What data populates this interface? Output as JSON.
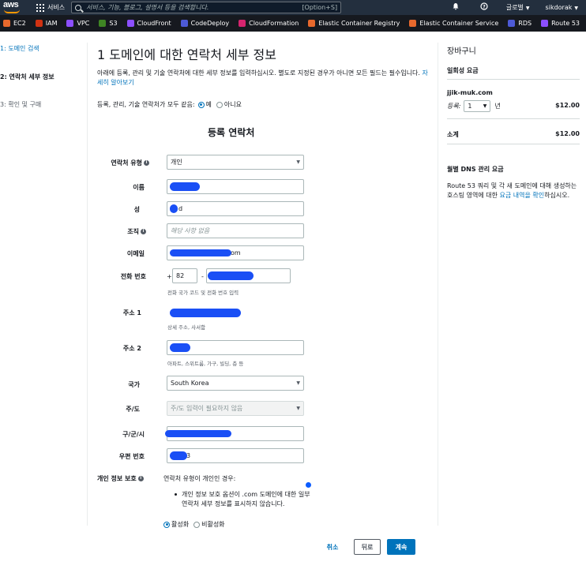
{
  "topnav": {
    "logo": "aws",
    "services_label": "서비스",
    "search_placeholder": "서비스, 기능, 블로그, 설명서 등을 검색합니다.",
    "search_shortcut": "[Option+S]",
    "bell_icon": "bell-icon",
    "help_icon": "help-icon",
    "region": "글로벌",
    "user": "sikdorak"
  },
  "favorites": [
    {
      "label": "EC2",
      "color": "#e8692d"
    },
    {
      "label": "IAM",
      "color": "#d13212"
    },
    {
      "label": "VPC",
      "color": "#8c4fff"
    },
    {
      "label": "S3",
      "color": "#3f8624"
    },
    {
      "label": "CloudFront",
      "color": "#8c4fff"
    },
    {
      "label": "CodeDeploy",
      "color": "#4d5ad6"
    },
    {
      "label": "CloudFormation",
      "color": "#d6246e"
    },
    {
      "label": "Elastic Container Registry",
      "color": "#e8692d"
    },
    {
      "label": "Elastic Container Service",
      "color": "#e8692d"
    },
    {
      "label": "RDS",
      "color": "#4d5ad6"
    },
    {
      "label": "Route 53",
      "color": "#8c4fff"
    }
  ],
  "steps": {
    "s1": "1: 도메인 검색",
    "s2": "2: 연락처 세부 정보",
    "s3": "3: 확인 및 구매"
  },
  "main": {
    "title": "1 도메인에 대한 연락처 세부 정보",
    "intro": "아래에 등록, 관리 및 기술 연락처에 대한 세부 정보를 입력하십시오. 별도로 지정된 경우가 아니면 모든 필드는 필수입니다.",
    "learn_more": "자세히 알아보기",
    "same_contacts_label": "등록, 관리, 기술 연락처가 모두 같음:",
    "yes": "예",
    "no": "아니요",
    "section_title": "등록 연락처"
  },
  "form": {
    "contact_type": {
      "label": "연락처 유형",
      "value": "개인"
    },
    "first_name": {
      "label": "이름",
      "value": ""
    },
    "last_name": {
      "label": "성",
      "value": "d"
    },
    "organization": {
      "label": "조직",
      "placeholder": "해당 사항 없음"
    },
    "email": {
      "label": "이메일",
      "value_suffix": "om"
    },
    "phone": {
      "label": "전화 번호",
      "plus": "+",
      "country_code": "82",
      "dash": "-",
      "hint": "전화 국가 코드 및 전화 번호 입력"
    },
    "address1": {
      "label": "주소 1",
      "hint": "상세 주소, 사서함"
    },
    "address2": {
      "label": "주소 2",
      "hint": "아파트, 스위트룸, 가구, 빌딩, 층 등"
    },
    "country": {
      "label": "국가",
      "value": "South Korea"
    },
    "state": {
      "label": "주/도",
      "value": "주/도 입력이 필요하지 않음"
    },
    "city": {
      "label": "구/군/시"
    },
    "postal": {
      "label": "우편 번호",
      "value_suffix": "3"
    },
    "privacy": {
      "label": "개인 정보 보호",
      "intro": "연락처 유형이 개인인 경우:",
      "bullet": "개인 정보 보호 옵션이 .com 도메인에 대한 일부 연락처 세부 정보를 표시하지 않습니다.",
      "enable": "활성화",
      "disable": "비활성화"
    }
  },
  "cart": {
    "title": "장바구니",
    "one_time_fee": "일회성 요금",
    "domain": "jjik-muk.com",
    "register_label": "등록:",
    "years_value": "1",
    "years_unit": "년",
    "price": "$12.00",
    "subtotal_label": "소계",
    "subtotal_price": "$12.00",
    "dns_title": "월별 DNS 관리 요금",
    "dns_text_pre": "Route 53 쿼리 및 각 새 도메인에 대해 생성하는 호스팅 영역에 대한",
    "dns_link": "요금 내역을 확인",
    "dns_text_post": "하십시오."
  },
  "buttons": {
    "cancel": "취소",
    "back": "뒤로",
    "next": "계속"
  },
  "colors": {
    "accent": "#0073bb",
    "redaction": "#1a4ff5",
    "nav_bg": "#232f3e"
  }
}
